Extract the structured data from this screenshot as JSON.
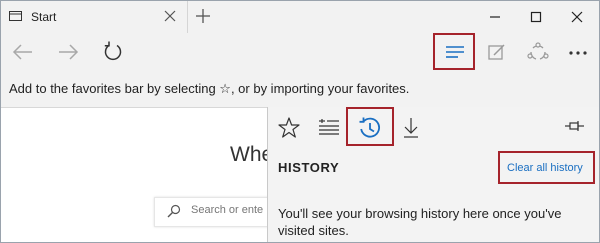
{
  "tab": {
    "title": "Start",
    "icon": "page-icon",
    "close_icon": "close-icon"
  },
  "window_controls": [
    "minimize-icon",
    "maximize-icon",
    "close-icon"
  ],
  "nav": {
    "buttons": [
      "back-arrow-icon",
      "forward-arrow-icon",
      "refresh-icon"
    ],
    "right_buttons": [
      "hub-icon",
      "web-note-icon",
      "share-icon",
      "more-icon"
    ]
  },
  "favorites_bar": {
    "message": "Add to the favorites bar by selecting ☆, or by importing your favorites."
  },
  "page": {
    "welcome_partial": "Whe",
    "search_placeholder_partial": "Search or ente"
  },
  "hub": {
    "tabs": [
      "favorites-star-icon",
      "reading-list-icon",
      "history-icon",
      "downloads-icon"
    ],
    "active_tab": "history-icon",
    "heading": "HISTORY",
    "clear_link": "Clear all history",
    "empty_message": "You'll see your browsing history here once you've visited sites."
  },
  "colors": {
    "accent": "#1a6fc2",
    "highlight_border": "#a5232b",
    "chrome_bg": "#f2f2f2"
  }
}
